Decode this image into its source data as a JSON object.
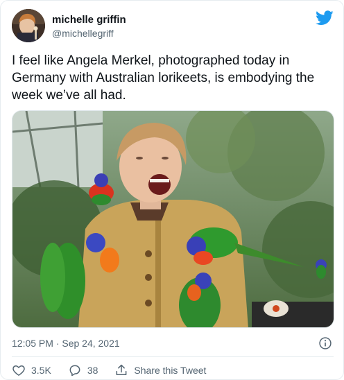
{
  "user": {
    "display_name": "michelle griffin",
    "handle": "@michellegriff"
  },
  "tweet": {
    "text": "I feel like Angela Merkel, photographed today in Germany with Australian lorikeets, is embodying the week we’ve all had."
  },
  "meta": {
    "timestamp": "12:05 PM · Sep 24, 2021"
  },
  "actions": {
    "likes_count": "3.5K",
    "replies_count": "38",
    "share_label": "Share this Tweet"
  },
  "colors": {
    "twitter_blue": "#1d9bf0",
    "secondary_text": "#536471",
    "primary_text": "#0f1419"
  },
  "icons": {
    "brand": "twitter-bird-icon",
    "info": "info-icon",
    "like": "heart-icon",
    "reply": "reply-bubble-icon",
    "share": "share-upload-icon"
  }
}
